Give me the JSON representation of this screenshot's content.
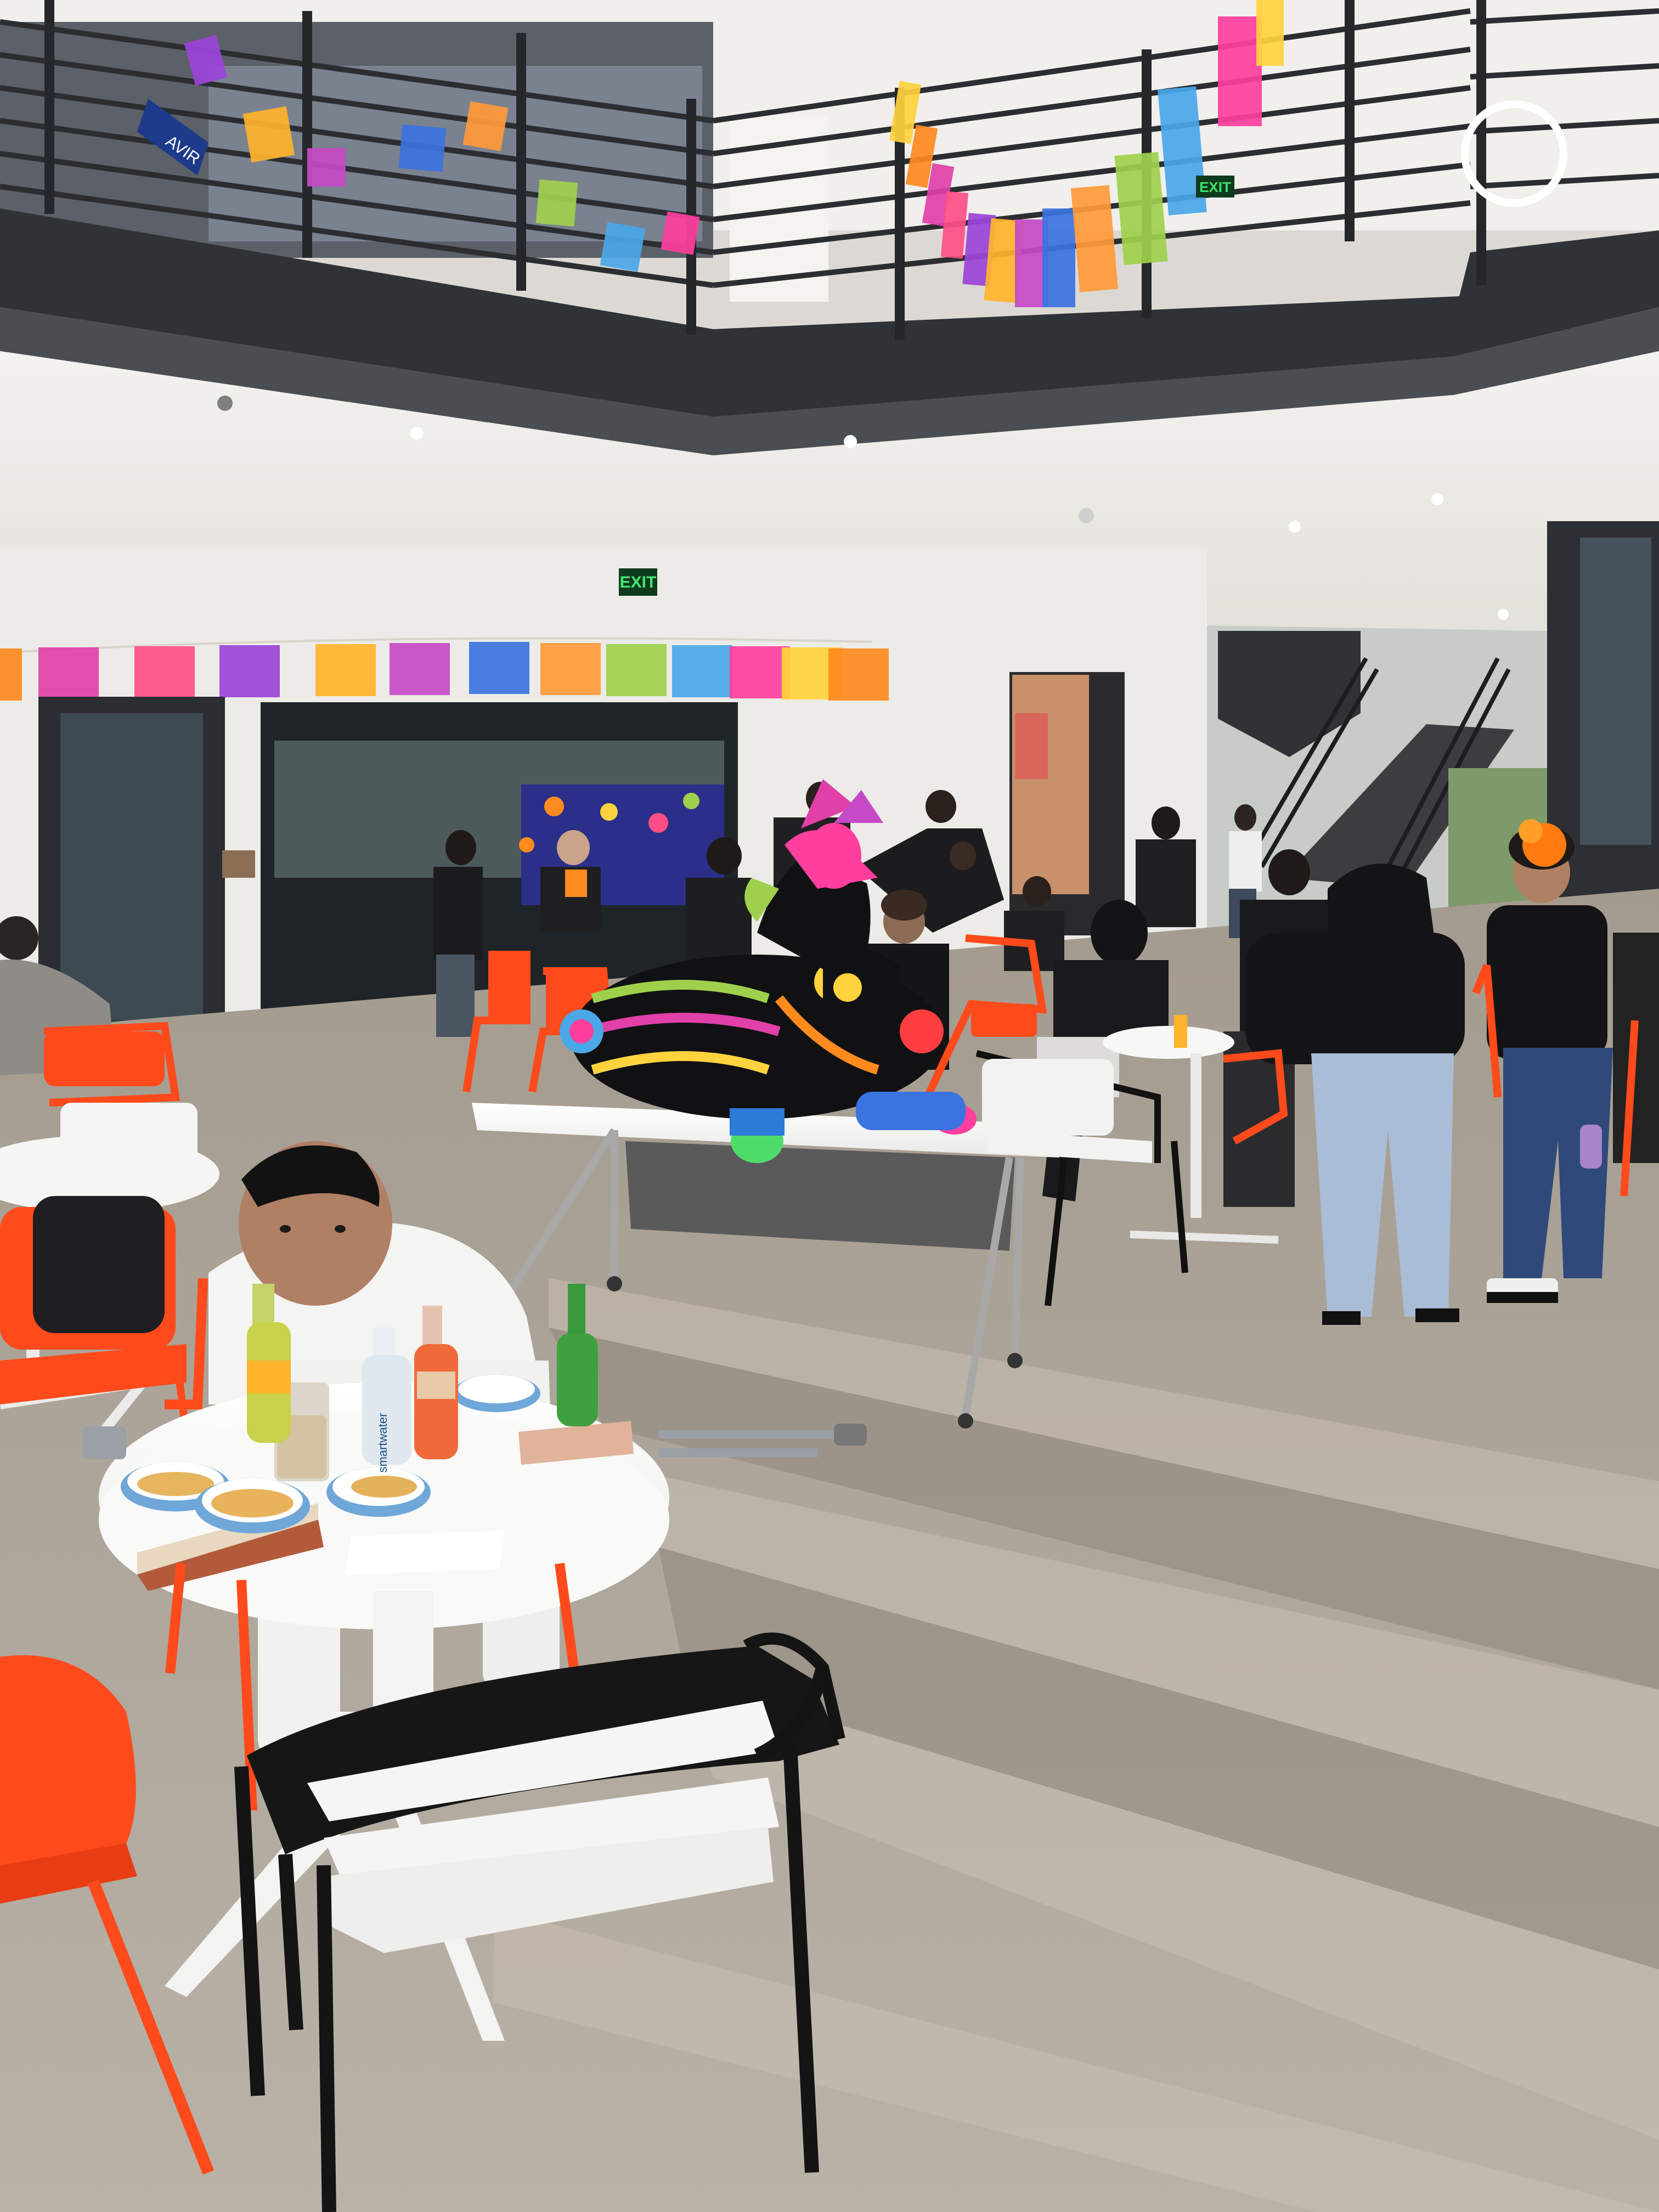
{
  "scene": {
    "exit_sign_text": "EXIT",
    "exit_sign_upper_text": "EXIT",
    "bottle_label_text": "smartwater",
    "upper_banner_text": "AVIR",
    "colors": {
      "floor_light": "#b9b0a3",
      "floor_shadow": "#8e8679",
      "wall": "#ebe8e2",
      "ceiling": "#f1efeb",
      "balcony_dark": "#3c3f44",
      "chair_orange": "#ff4a1c",
      "table_white": "#f7f7f5",
      "exit_green": "#2f9a43"
    },
    "papel_picado_colors": [
      "#ff8a1e",
      "#e040a8",
      "#ff4f86",
      "#9b44d8",
      "#ffb42b",
      "#c64ac8",
      "#3b73e0",
      "#ff9a3a",
      "#9fd04c",
      "#4aa7e8",
      "#ff3f9e",
      "#ffd33d"
    ]
  }
}
